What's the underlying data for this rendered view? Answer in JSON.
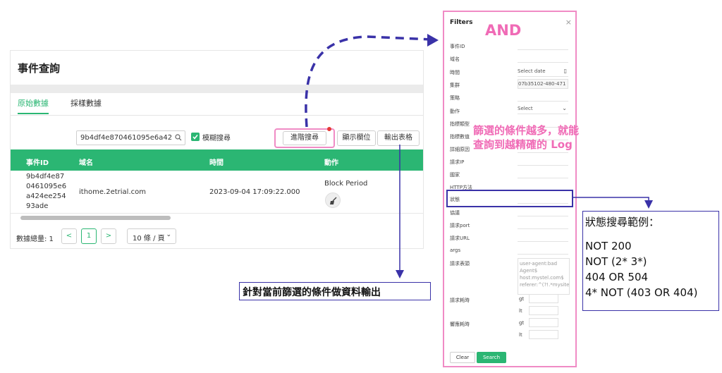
{
  "page": {
    "title": "事件查詢",
    "tabs": [
      {
        "label": "原始數據",
        "active": true
      },
      {
        "label": "採樣數據",
        "active": false
      }
    ],
    "search": {
      "value": "9b4df4e870461095e6a42"
    },
    "fuzzy_search_label": "模糊搜尋",
    "buttons": {
      "advanced": "進階搜尋",
      "columns": "顯示欄位",
      "export": "輸出表格"
    },
    "table": {
      "headers": [
        "事件ID",
        "域名",
        "時間",
        "動作"
      ],
      "rows": [
        {
          "id": "9b4df4e870461095e6a424ee25493ade",
          "domain": "ithome.2etrial.com",
          "time": "2023-09-04 17:09:22.000",
          "action": "Block Period"
        }
      ]
    },
    "pagination": {
      "total_label": "數據總量: 1",
      "prev": "<",
      "current": "1",
      "next": ">",
      "page_size": "10 條 / 頁"
    }
  },
  "filters": {
    "title": "Filters",
    "close": "×",
    "and_label": "AND",
    "fields": [
      {
        "label": "事件ID",
        "value": ""
      },
      {
        "label": "域名",
        "value": ""
      },
      {
        "label": "時間",
        "value": "Select date"
      },
      {
        "label": "集群",
        "value": "07b35102-480-471"
      },
      {
        "label": "策略",
        "value": ""
      },
      {
        "label": "動作",
        "value": "Select"
      },
      {
        "label": "指標類型",
        "value": ""
      },
      {
        "label": "指標數值",
        "value": ""
      },
      {
        "label": "詳細原因",
        "value": ""
      },
      {
        "label": "請求IP",
        "value": ""
      },
      {
        "label": "國家",
        "value": ""
      },
      {
        "label": "HTTP方法",
        "value": ""
      },
      {
        "label": "狀態",
        "value": ""
      },
      {
        "label": "協議",
        "value": ""
      },
      {
        "label": "請求port",
        "value": ""
      },
      {
        "label": "請求URL",
        "value": ""
      },
      {
        "label": "args",
        "value": ""
      },
      {
        "label": "請求表頭",
        "value": "user-agent:bad Agent$ host:mystel.com$ referer:^(?!.*mysite"
      },
      {
        "label": "請求耗時",
        "gt": "gt",
        "lt": "lt"
      },
      {
        "label": "響應耗時",
        "gt": "gt",
        "lt": "lt"
      }
    ],
    "clear": "Clear",
    "search": "Search",
    "note": "篩選的條件越多，就能查詢到越精確的 Log"
  },
  "callouts": {
    "export": "針對當前篩選的條件做資料輸出",
    "status_title": "狀態搜尋範例：",
    "status_examples": [
      "NOT 200",
      "NOT (2* 3*)",
      "404 OR 504",
      "4* NOT (403 OR 404)"
    ]
  },
  "colors": {
    "accent": "#2bb673",
    "pink": "#f06bb6",
    "navy": "#3a32a8"
  }
}
